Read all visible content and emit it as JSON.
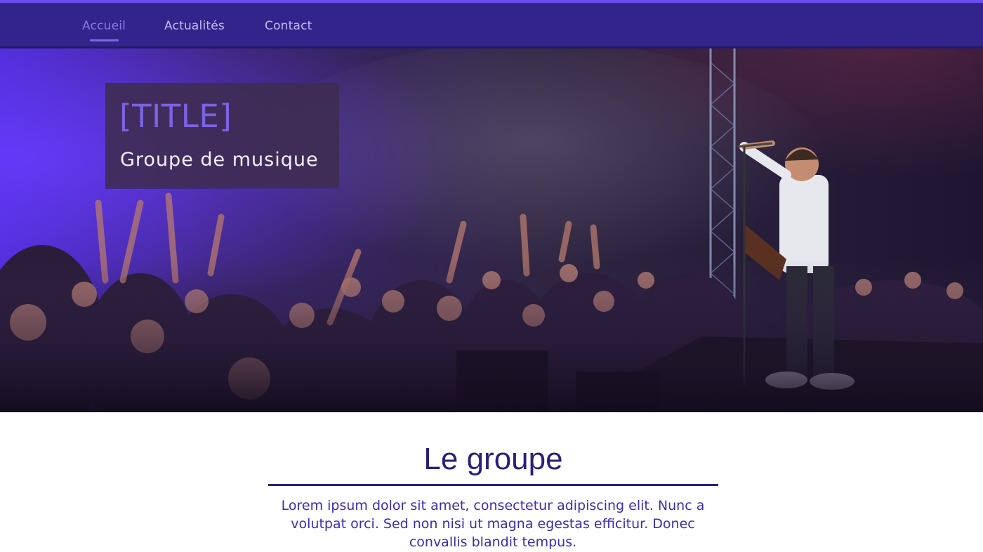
{
  "nav": {
    "items": [
      {
        "label": "Accueil",
        "active": true
      },
      {
        "label": "Actualités",
        "active": false
      },
      {
        "label": "Contact",
        "active": false
      }
    ]
  },
  "hero": {
    "title": "[TITLE]",
    "subtitle": "Groupe de musique",
    "image": "concert-photo"
  },
  "section": {
    "title": "Le groupe",
    "text": "Lorem ipsum dolor sit amet, consectetur adipiscing elit. Nunc a volutpat orci. Sed non nisi ut magna egestas efficitur. Donec convallis blandit tempus."
  },
  "colors": {
    "nav_bg": "#33248c",
    "nav_accent": "#6a4df0",
    "title_purple": "#7c63e3",
    "heading_dark": "#2c1f78",
    "text_purple": "#3d2bb0"
  }
}
